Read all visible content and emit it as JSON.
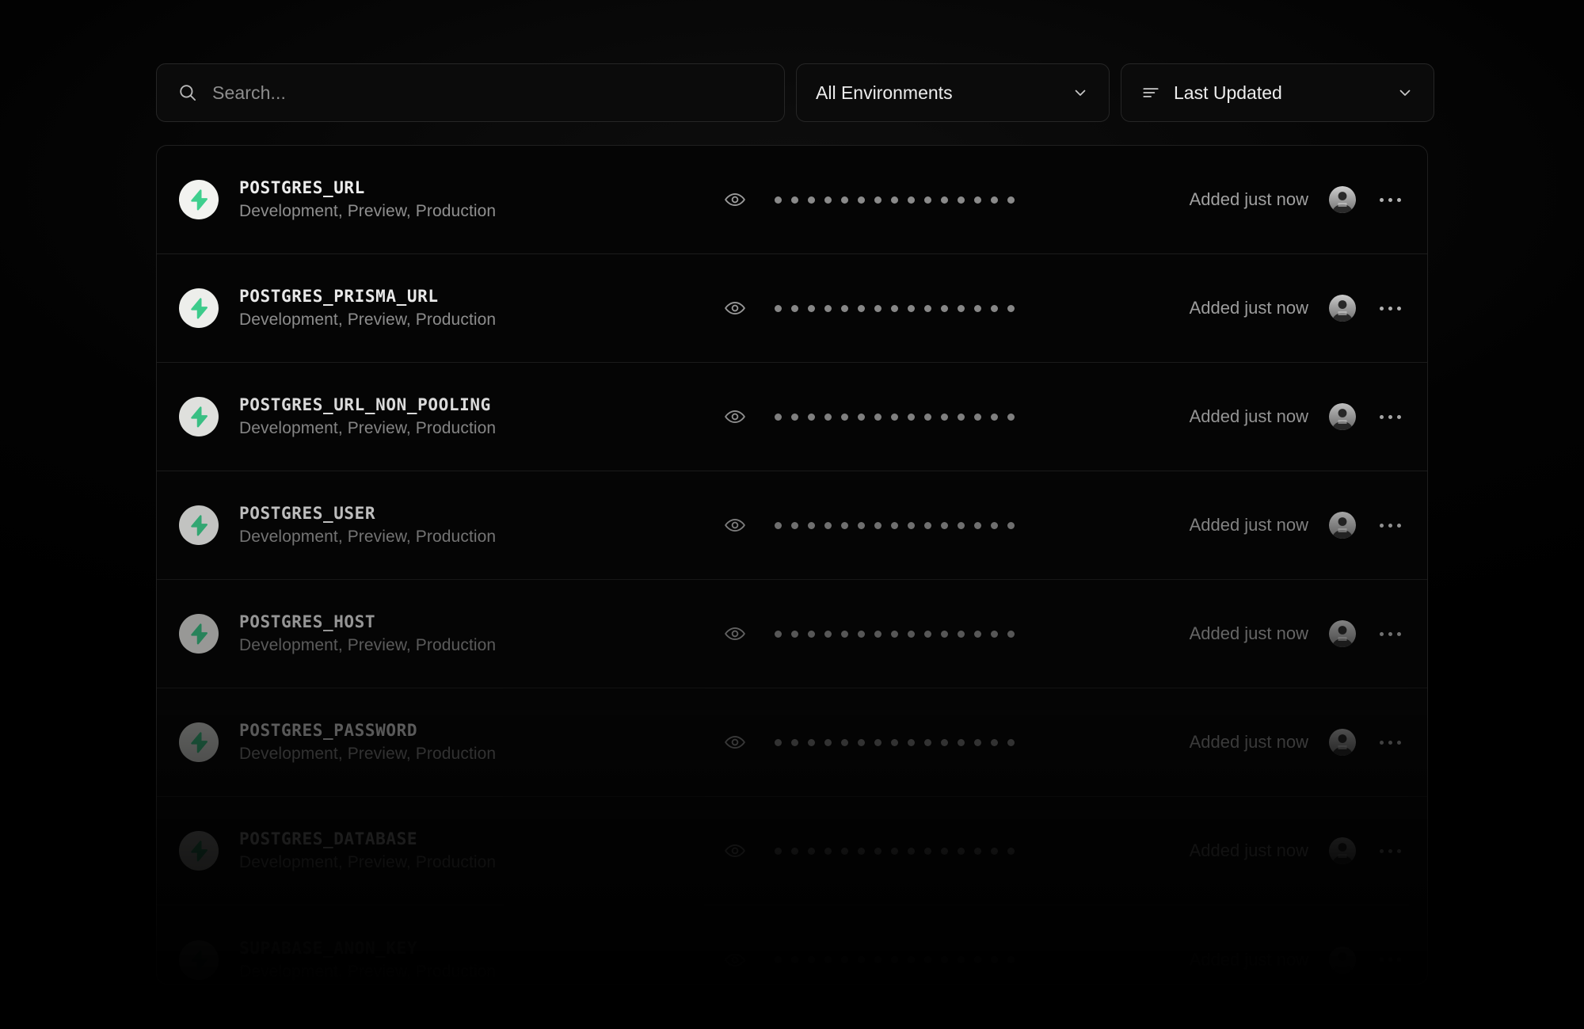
{
  "theme": {
    "page_background": "#000000",
    "card_background": "#050505",
    "border": "#262626",
    "text_primary": "#ededed",
    "text_secondary": "#8f8f8f",
    "accent_green": "#3ecf8e",
    "badge_background": "#f2f3f0"
  },
  "toolbar": {
    "search": {
      "placeholder": "Search...",
      "value": "",
      "icon": "search-icon"
    },
    "environment_filter": {
      "selected": "All Environments",
      "icon": "chevron-down-icon"
    },
    "sort": {
      "selected": "Last Updated",
      "leading_icon": "sort-lines-icon",
      "trailing_icon": "chevron-down-icon"
    }
  },
  "list": {
    "masked_dot_count": 15,
    "reveal_icon": "eye-icon",
    "more_icon": "more-horizontal-icon",
    "avatar_icon": "user-avatar",
    "rows": [
      {
        "key": "POSTGRES_URL",
        "targets": "Development, Preview, Production",
        "added": "Added just now"
      },
      {
        "key": "POSTGRES_PRISMA_URL",
        "targets": "Development, Preview, Production",
        "added": "Added just now"
      },
      {
        "key": "POSTGRES_URL_NON_POOLING",
        "targets": "Development, Preview, Production",
        "added": "Added just now"
      },
      {
        "key": "POSTGRES_USER",
        "targets": "Development, Preview, Production",
        "added": "Added just now"
      },
      {
        "key": "POSTGRES_HOST",
        "targets": "Development, Preview, Production",
        "added": "Added just now"
      },
      {
        "key": "POSTGRES_PASSWORD",
        "targets": "Development, Preview, Production",
        "added": "Added just now"
      },
      {
        "key": "POSTGRES_DATABASE",
        "targets": "Development, Preview, Production",
        "added": "Added just now"
      },
      {
        "key": "SUPABASE_ANON_KEY",
        "targets": "Development, Preview, Production",
        "added": "Added just now"
      }
    ]
  }
}
